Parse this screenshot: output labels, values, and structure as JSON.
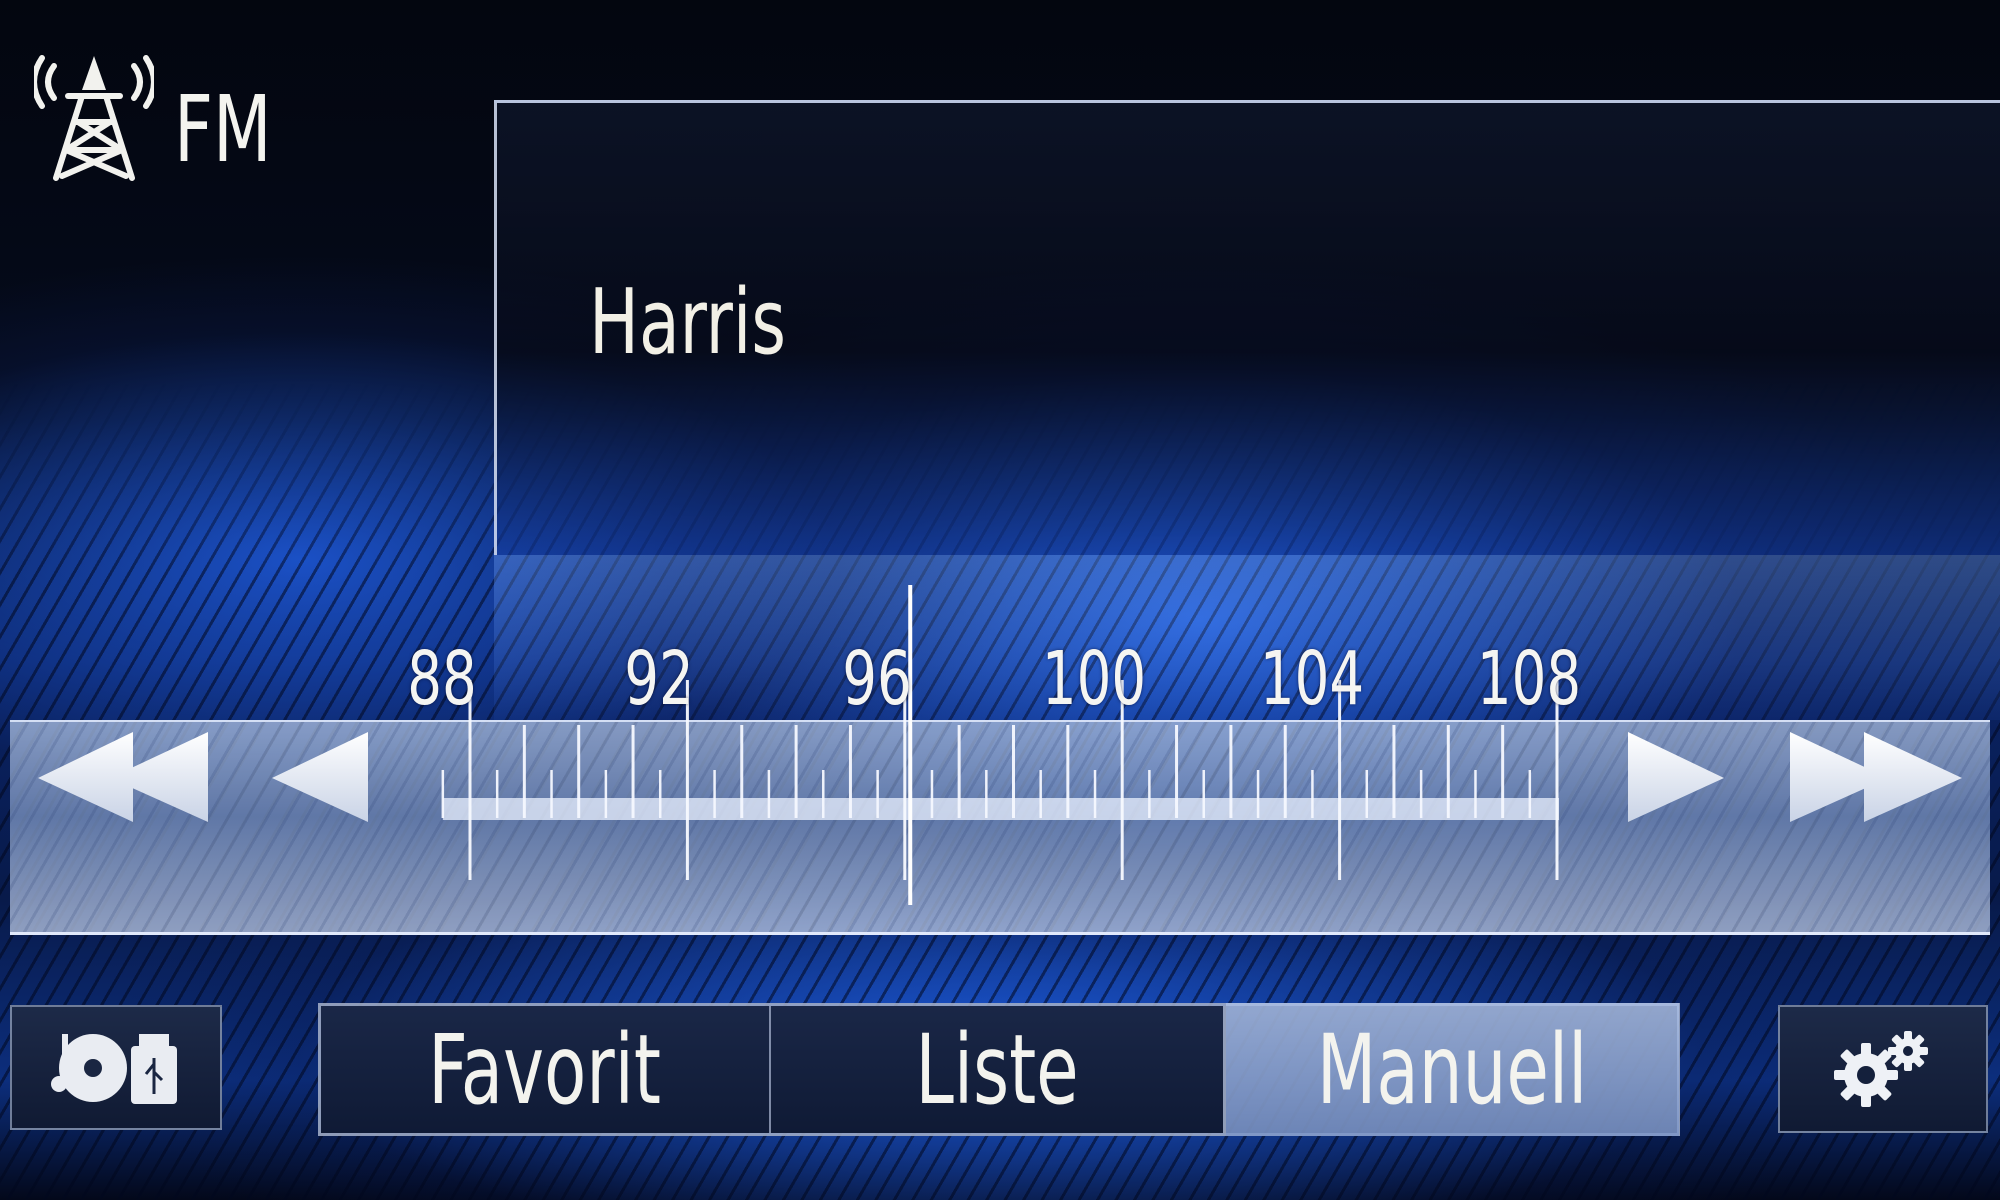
{
  "header": {
    "band_icon": "radio-tower-icon",
    "band_label": "FM"
  },
  "station": {
    "name": "Harris"
  },
  "tuner": {
    "scale_labels": [
      "88",
      "92",
      "96",
      "100",
      "104",
      "108"
    ],
    "range_mhz": [
      87.5,
      108
    ],
    "current_frequency_mhz": 96.1,
    "controls": {
      "seek_back_icon": "double-left-arrow-icon",
      "step_back_icon": "left-arrow-icon",
      "step_forward_icon": "right-arrow-icon",
      "seek_forward_icon": "double-right-arrow-icon"
    }
  },
  "bottom_bar": {
    "source_icon": "cd-usb-source-icon",
    "modes": [
      "Favorit",
      "Liste",
      "Manuell"
    ],
    "active_mode": "Manuell",
    "settings_icon": "gear-icon"
  },
  "colors": {
    "accent_blue": "#1f5fd8",
    "text": "#f2f2ee",
    "active_button": "#a6b8de"
  }
}
